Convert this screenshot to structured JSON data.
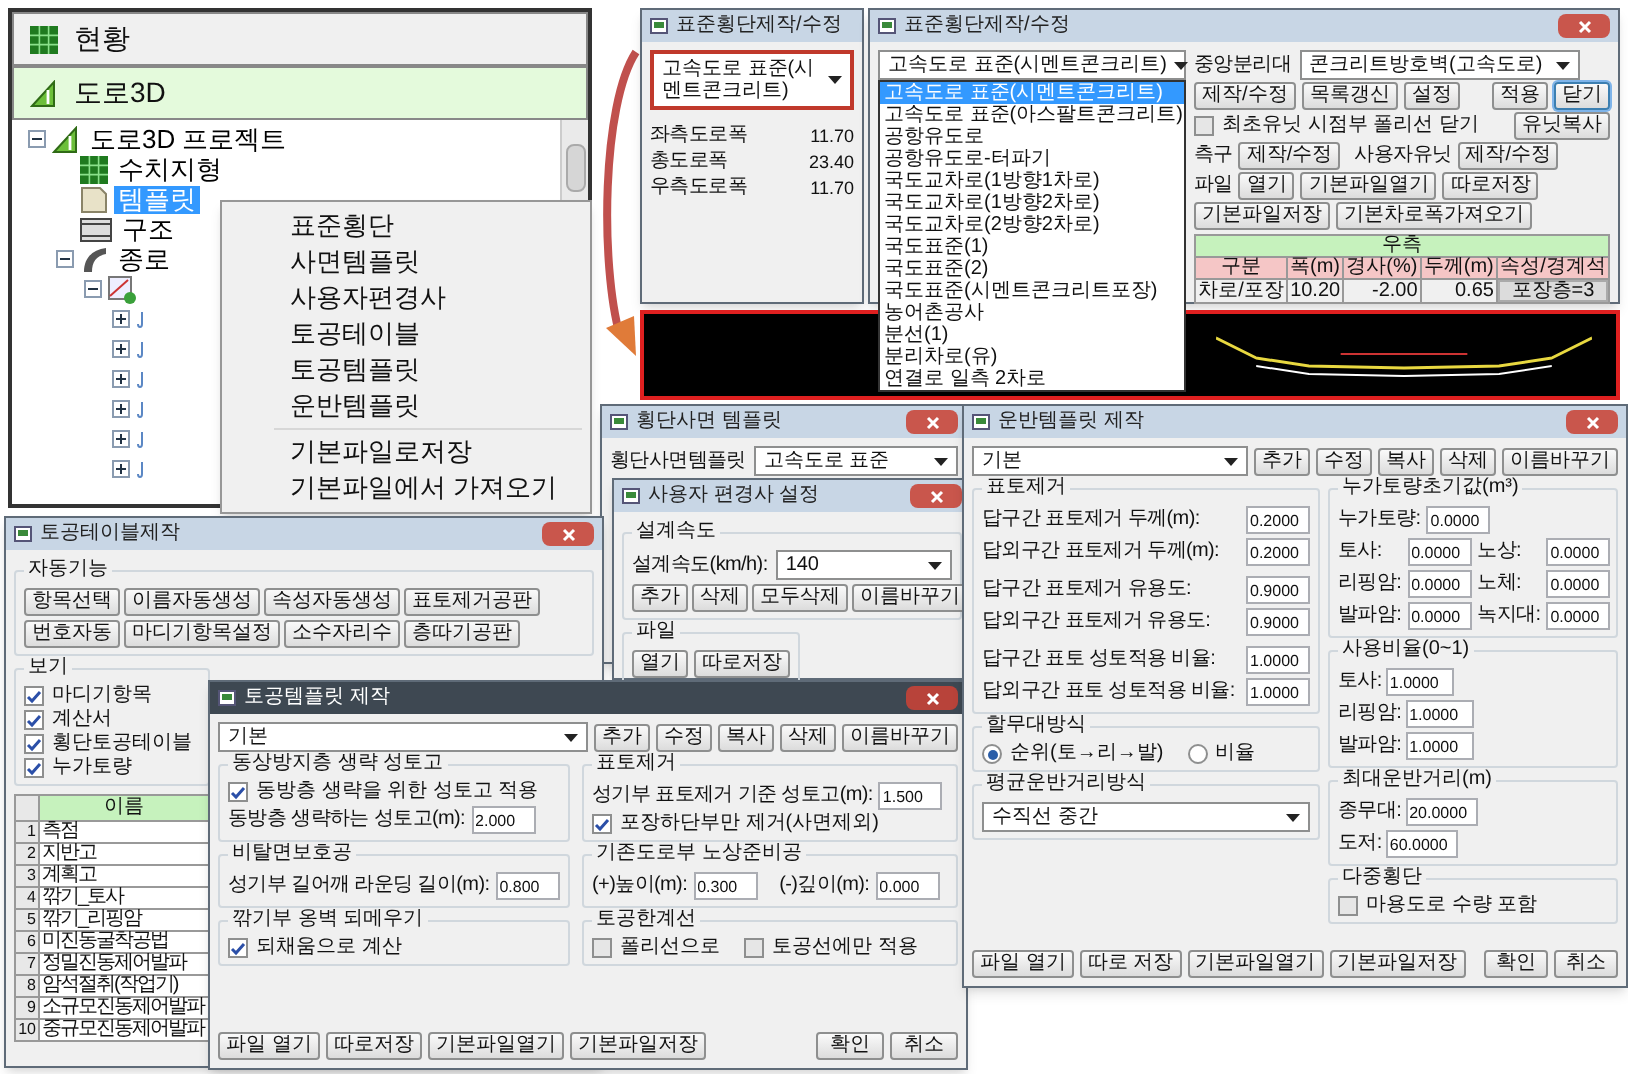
{
  "explorer": {
    "tabs": [
      {
        "label": "현황",
        "kind": "grid",
        "selected": false
      },
      {
        "label": "도로3D",
        "kind": "road",
        "selected": true
      }
    ],
    "tree": [
      {
        "label": "도로3D 프로젝트",
        "kind": "project",
        "expanded": true,
        "selected": false,
        "children": [
          {
            "label": "수치지형",
            "kind": "grid",
            "selected": false
          },
          {
            "label": "템플릿",
            "kind": "template",
            "selected": true
          },
          {
            "label": "구조",
            "kind": "structure",
            "selected": false
          },
          {
            "label": "종로",
            "kind": "curve",
            "expanded": true,
            "selected": false,
            "children": [
              {
                "kind": "alignment",
                "expanded": true,
                "children": [
                  {
                    "kind": "station",
                    "expanded": false
                  },
                  {
                    "kind": "station",
                    "expanded": false
                  },
                  {
                    "kind": "station",
                    "expanded": false
                  },
                  {
                    "kind": "station",
                    "expanded": false
                  },
                  {
                    "kind": "station",
                    "expanded": false
                  },
                  {
                    "kind": "station",
                    "expanded": false
                  }
                ]
              }
            ]
          }
        ]
      }
    ]
  },
  "context_menu": {
    "groups": [
      [
        "표준횡단",
        "사면템플릿",
        "사용자편경사",
        "토공테이블",
        "토공템플릿",
        "운반템플릿"
      ],
      [
        "기본파일로저장",
        "기본파일에서 가져오기"
      ]
    ]
  },
  "cross_section_back": {
    "title": "표준횡단제작/수정",
    "template": "고속도로 표준(시멘트콘크리트)",
    "highlighted": true,
    "widths": [
      {
        "label": "좌측도로폭",
        "value": "11.70"
      },
      {
        "label": "총도로폭",
        "value": "23.40"
      },
      {
        "label": "우측도로폭",
        "value": "11.70"
      }
    ]
  },
  "cross_section": {
    "title": "표준횡단제작/수정",
    "template": "고속도로 표준(시멘트콘크리트)",
    "options": [
      {
        "label": "고속도로 표준(시멘트콘크리트)",
        "selected": true
      },
      {
        "label": "고속도로 표준(아스팔트콘크리트)",
        "selected": false
      },
      {
        "label": "공항유도로",
        "selected": false
      },
      {
        "label": "공항유도로-터파기",
        "selected": false
      },
      {
        "label": "국도교차로(1방향1차로)",
        "selected": false
      },
      {
        "label": "국도교차로(1방향2차로)",
        "selected": false
      },
      {
        "label": "국도교차로(2방향2차로)",
        "selected": false
      },
      {
        "label": "국도표준(1)",
        "selected": false
      },
      {
        "label": "국도표준(2)",
        "selected": false
      },
      {
        "label": "국도표준(시멘트콘크리트포장)",
        "selected": false
      },
      {
        "label": "농어촌공사",
        "selected": false
      },
      {
        "label": "분선(1)",
        "selected": false
      },
      {
        "label": "분리차로(유)",
        "selected": false
      },
      {
        "label": "연결로 일측 2차로",
        "selected": false
      }
    ],
    "median": {
      "title": "중앙분리대",
      "value": "콘크리트방호벽(고속도로)",
      "buttons": [
        "제작/수정",
        "목록갱신",
        "설정"
      ]
    },
    "side_buttons": [
      {
        "label": "적용",
        "selected": false
      },
      {
        "label": "닫기",
        "selected": true
      }
    ],
    "close_polyline": {
      "label": "최초유닛 시점부 폴리선 닫기",
      "checked": false
    },
    "unit_copy": "유닛복사",
    "gutter": {
      "title": "측구",
      "button": "제작/수정"
    },
    "user_unit": {
      "title": "사용자유닛",
      "button": "제작/수정"
    },
    "file": {
      "title": "파일",
      "buttons": [
        "열기",
        "기본파일열기",
        "따로저장"
      ]
    },
    "file_more": [
      "기본파일저장",
      "기본차로폭가져오기"
    ],
    "right_table": {
      "title": "우측",
      "columns": [
        "구분",
        "폭(m)",
        "경사(%)",
        "두께(m)",
        "속성/경계석"
      ],
      "rows": [
        [
          "차로/포장",
          "10.20",
          "-2.00",
          "0.65",
          "포장층=3"
        ]
      ]
    }
  },
  "preview": {
    "highlighted": true
  },
  "slope_template": {
    "title": "횡단사면 템플릿",
    "label": "횡단사면템플릿",
    "template": "고속도로 표준"
  },
  "superelevation": {
    "title": "사용자 편경사 설정",
    "speed_group": "설계속도",
    "speed_label": "설계속도(km/h):",
    "speed": "140",
    "buttons": [
      "추가",
      "삭제",
      "모두삭제",
      "이름바꾸기"
    ],
    "file_group": "파일",
    "file_buttons": [
      "열기",
      "따로저장"
    ]
  },
  "earthwork_table": {
    "title": "토공테이블제작",
    "auto_group": "자동기능",
    "auto_buttons": [
      "항목선택",
      "이름자동생성",
      "속성자동생성",
      "표토제거공판",
      "번호자동",
      "마디기항목설정",
      "소수자리수",
      "층따기공판"
    ],
    "view_group": "보기",
    "view_options": [
      {
        "label": "마디기항목",
        "checked": true
      },
      {
        "label": "계산서",
        "checked": true
      },
      {
        "label": "횡단토공테이블",
        "checked": true
      },
      {
        "label": "누가토량",
        "checked": true
      }
    ],
    "column": "이름",
    "rows": [
      {
        "no": "1",
        "name": "측점"
      },
      {
        "no": "2",
        "name": "지반고"
      },
      {
        "no": "3",
        "name": "계획고"
      },
      {
        "no": "4",
        "name": "깎기_토사"
      },
      {
        "no": "5",
        "name": "깎기_리핑암"
      },
      {
        "no": "6",
        "name": "미진동굴착공법"
      },
      {
        "no": "7",
        "name": "정밀진동제어발파"
      },
      {
        "no": "8",
        "name": "암석절취(작업기)"
      },
      {
        "no": "9",
        "name": "소규모진동제어발파"
      },
      {
        "no": "10",
        "name": "중규모진동제어발파"
      }
    ]
  },
  "earthwork_template": {
    "title": "토공템플릿 제작",
    "template": "기본",
    "buttons": [
      "추가",
      "수정",
      "복사",
      "삭제",
      "이름바꾸기"
    ],
    "groups": [
      {
        "title": "동상방지층 생략 성토고",
        "items": [
          {
            "kind": "check",
            "label": "동방층 생략을 위한 성토고 적용",
            "checked": true
          },
          {
            "kind": "field",
            "label": "동방층 생략하는 성토고(m):",
            "value": "2.000"
          }
        ]
      },
      {
        "title": "표토제거",
        "items": [
          {
            "kind": "field",
            "label": "성기부 표토제거 기준 성토고(m):",
            "value": "1.500"
          },
          {
            "kind": "check",
            "label": "포장하단부만 제거(사면제외)",
            "checked": true
          }
        ]
      },
      {
        "title": "비탈면보호공",
        "items": [
          {
            "kind": "field",
            "label": "성기부 길어깨 라운딩 길이(m):",
            "value": "0.800"
          }
        ]
      },
      {
        "title": "기존도로부 노상준비공",
        "items": [
          {
            "kind": "fields",
            "fields": [
              {
                "label": "(+)높이(m):",
                "value": "0.300"
              },
              {
                "label": "(-)깊이(m):",
                "value": "0.000"
              }
            ]
          }
        ]
      },
      {
        "title": "깎기부 옹벽 되메우기",
        "items": [
          {
            "kind": "check",
            "label": "되채움으로 계산",
            "checked": true
          }
        ]
      },
      {
        "title": "토공한계선",
        "items": [
          {
            "kind": "checks",
            "checks": [
              {
                "label": "폴리선으로",
                "checked": false
              },
              {
                "label": "토공선에만 적용",
                "checked": false
              }
            ]
          }
        ]
      }
    ],
    "footer": [
      "파일 열기",
      "따로저장",
      "기본파일열기",
      "기본파일저장"
    ],
    "actions": [
      "확인",
      "취소"
    ]
  },
  "haul_template": {
    "title": "운반템플릿 제작",
    "template": "기본",
    "buttons": [
      "추가",
      "수정",
      "복사",
      "삭제",
      "이름바꾸기"
    ],
    "topsoil": {
      "title": "표토제거",
      "fields": [
        {
          "label": "답구간 표토제거 두께(m):",
          "value": "0.2000"
        },
        {
          "label": "답외구간 표토제거 두께(m):",
          "value": "0.2000"
        },
        {
          "label": "답구간 표토제거 유용도:",
          "value": "0.9000"
        },
        {
          "label": "답외구간 표토제거 유용도:",
          "value": "0.9000"
        },
        {
          "label": "답구간 표토 성토적용 비율:",
          "value": "1.0000"
        },
        {
          "label": "답외구간 표토 성토적용 비율:",
          "value": "1.0000"
        }
      ]
    },
    "cumulative": {
      "title": "누가토량초기값(m³)",
      "total": {
        "label": "누가토량:",
        "value": "0.0000"
      },
      "fields": [
        {
          "label": "토사:",
          "value": "0.0000"
        },
        {
          "label": "노상:",
          "value": "0.0000"
        },
        {
          "label": "리핑암:",
          "value": "0.0000"
        },
        {
          "label": "노체:",
          "value": "0.0000"
        },
        {
          "label": "발파암:",
          "value": "0.0000"
        },
        {
          "label": "녹지대:",
          "value": "0.0000"
        }
      ]
    },
    "usage": {
      "title": "사용비율(0~1)",
      "fields": [
        {
          "label": "토사:",
          "value": "1.0000"
        },
        {
          "label": "리핑암:",
          "value": "1.0000"
        },
        {
          "label": "발파암:",
          "value": "1.0000"
        }
      ]
    },
    "max_distance": {
      "title": "최대운반거리(m)",
      "fields": [
        {
          "label": "종무대:",
          "value": "20.0000"
        },
        {
          "label": "도저:",
          "value": "60.0000"
        }
      ]
    },
    "distribution": {
      "title": "할무대방식",
      "options": [
        {
          "label": "순위(토→리→발)",
          "selected": true
        },
        {
          "label": "비율",
          "selected": false
        }
      ]
    },
    "avg_method": {
      "title": "평균운반거리방식",
      "value": "수직선 중간"
    },
    "multi": {
      "title": "다중횡단",
      "label": "마용도로 수량 포함",
      "checked": false
    },
    "footer": [
      "파일 열기",
      "따로 저장",
      "기본파일열기",
      "기본파일저장"
    ],
    "actions": [
      "확인",
      "취소"
    ]
  }
}
